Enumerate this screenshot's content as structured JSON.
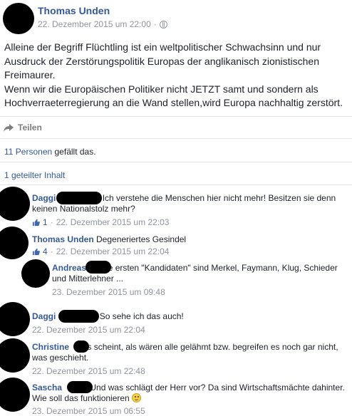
{
  "post": {
    "author": "Thomas Unden",
    "timestamp": "22. Dezember 2015 um 22:00",
    "separator": "·",
    "privacy_icon": "globe-icon",
    "text_lines": [
      "Alleine der Begriff Flüchtling ist ein weltpolitischer Schwachsinn und nur Ausdruck der Zerstörungspolitik Europas der anglikanisch zionistischen Freimaurer.",
      "Wenn wir die Europäischen Politiker nicht JETZT samt und sondern als Hochverraeterregierung an die Wand stellen,wird Europa nachhaltig zerstört."
    ]
  },
  "actions": {
    "share_label": "Teilen",
    "share_icon": "share-arrow-icon"
  },
  "likes": {
    "link": "11 Personen",
    "suffix": " gefällt das."
  },
  "shares": {
    "label": "1 geteilter Inhalt"
  },
  "comments": [
    {
      "name": "Daggi",
      "text": "Ich verstehe die Menschen hier nicht mehr! Besitzen sie denn keinen Nationalstolz mehr?",
      "likes": "1",
      "timestamp": "22. Dezember 2015 um 22:03"
    },
    {
      "name": "Thomas Unden",
      "text": "Degeneriertes Gesindel",
      "likes": "4",
      "timestamp": "22. Dezember 2015 um 22:04"
    },
    {
      "name": "Andreas",
      "text": "Die ersten \"Kandidaten\" sind Merkel, Faymann, Klug, Schieder und Mitterlehner ...",
      "timestamp": "23. Dezember 2015 um 09:48"
    },
    {
      "name": "Daggi",
      "text": "So sehe ich das auch!",
      "timestamp": "22. Dezember 2015 um 22:04"
    },
    {
      "name": "Christine",
      "text": "Es scheint, als wären alle gelähmt bzw. begreifen es noch gar nicht, was geschieht.",
      "timestamp": "22. Dezember 2015 um 22:48"
    },
    {
      "name": "Sascha",
      "text": "Und was schlägt der Herr vor? Da sind Wirtschaftsmächte dahinter. Wie soll das funktionieren",
      "emoji": "smiley-icon",
      "timestamp": "23. Dezember 2015 um 06:55"
    }
  ]
}
